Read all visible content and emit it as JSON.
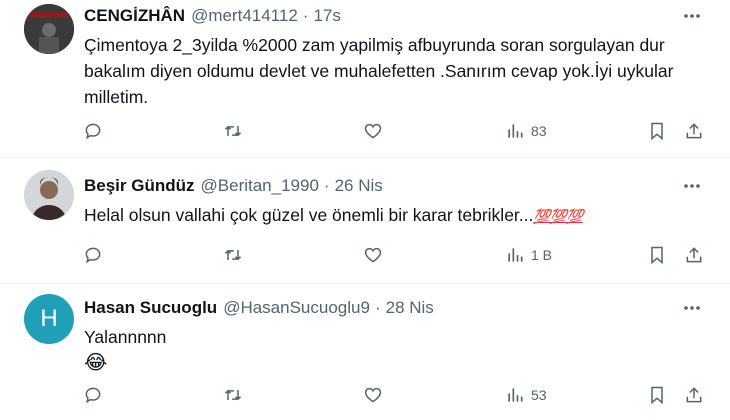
{
  "tweets": [
    {
      "name": "CENGİZHÂN",
      "handle": "@mert414112",
      "separator": "·",
      "time": "17s",
      "text": "Çimentoya 2_3yilda %2000 zam yapilmiş afbuyrunda soran sorgulayan dur bakalım diyen oldumu devlet ve muhalefetten .Sanırım cevap yok.İyi uykular milletim.",
      "views": "83",
      "avatar_icon": "dark-profile-photo"
    },
    {
      "name": "Beşir Gündüz",
      "handle": "@Beritan_1990",
      "separator": "·",
      "time": "26 Nis",
      "text": "Helal olsun vallahi çok güzel ve önemli bir karar tebrikler...",
      "emoji_suffix": "💯💯💯",
      "views": "1 B",
      "avatar_icon": "profile-photo"
    },
    {
      "name": "Hasan Sucuoglu",
      "handle": "@HasanSucuoglu9",
      "separator": "·",
      "time": "28 Nis",
      "text": "Yalannnnn",
      "emoji_line": "😂",
      "avatar_letter": "H",
      "avatar_color": "#1fa0b8",
      "views": "53"
    }
  ],
  "icons": {
    "reply": "reply-icon",
    "retweet": "retweet-icon",
    "like": "heart-icon",
    "views": "views-icon",
    "bookmark": "bookmark-icon",
    "share": "share-icon",
    "more": "more-icon"
  },
  "colors": {
    "secondary_text": "#536471",
    "divider": "#eff3f4"
  }
}
